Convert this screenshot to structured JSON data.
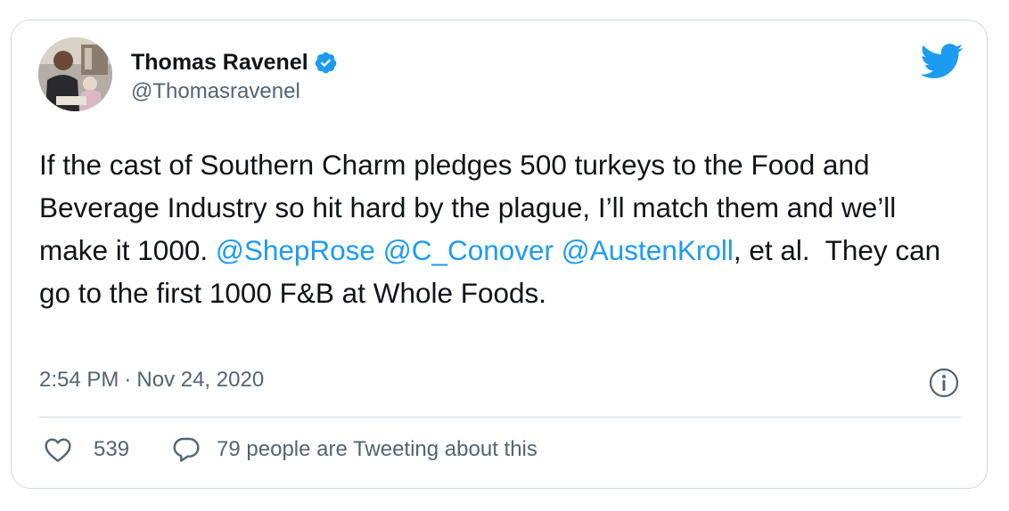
{
  "author": {
    "name": "Thomas Ravenel",
    "handle": "@Thomasravenel",
    "verified": true
  },
  "tweet": {
    "segments": [
      {
        "text": "If the cast of Southern Charm pledges 500 turkeys to the Food and Beverage Industry so hit hard by the plague, I’ll match them and we’ll make it 1000. ",
        "type": "text"
      },
      {
        "text": "@ShepRose",
        "type": "mention"
      },
      {
        "text": " ",
        "type": "text"
      },
      {
        "text": "@C_Conover",
        "type": "mention"
      },
      {
        "text": " ",
        "type": "text"
      },
      {
        "text": "@AustenKroll",
        "type": "mention"
      },
      {
        "text": ", et al.  They can go to the first 1000 F&B at Whole Foods.",
        "type": "text"
      }
    ],
    "time": "2:54 PM",
    "separator": "·",
    "date": "Nov 24, 2020"
  },
  "actions": {
    "likes": "539",
    "reply_label": "79 people are Tweeting about this"
  },
  "icons": {
    "brand": "twitter-bird-icon",
    "verified": "verified-badge-icon",
    "info": "info-icon",
    "like": "heart-icon",
    "reply": "speech-bubble-icon"
  },
  "colors": {
    "brand": "#1d9bf0",
    "text": "#0f1419",
    "secondary": "#536471",
    "border": "#cfd9de"
  }
}
